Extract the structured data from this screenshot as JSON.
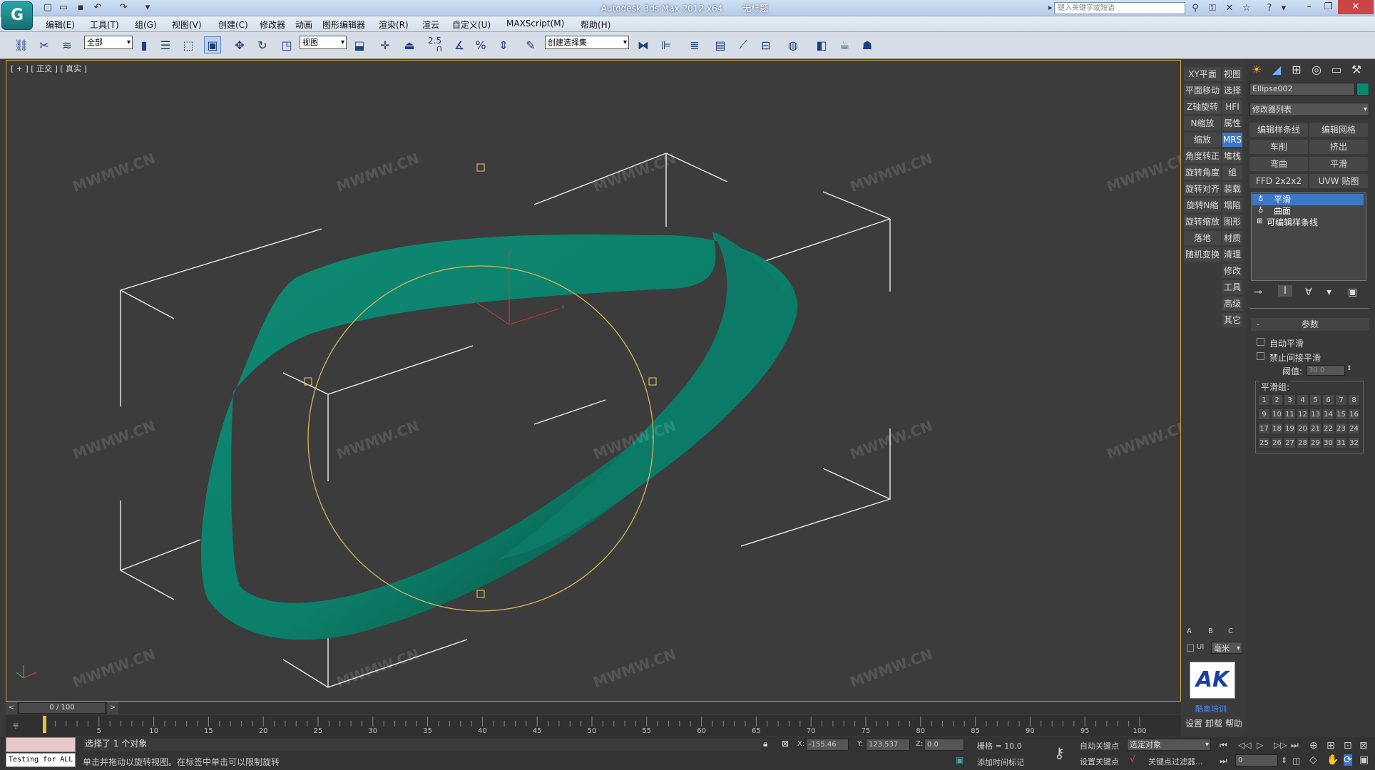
{
  "app": {
    "logo": "G",
    "title": "Autodesk 3ds Max  2012 x64",
    "doc": "无标题",
    "search_placeholder": "键入关键字或短语"
  },
  "quick_access": [
    "new-file-icon",
    "open-file-icon",
    "save-icon",
    "undo-icon",
    "redo-icon",
    "dropdown-icon"
  ],
  "menu": [
    "编辑(E)",
    "工具(T)",
    "组(G)",
    "视图(V)",
    "创建(C)",
    "修改器",
    "动画",
    "图形编辑器",
    "渲染(R)",
    "渲云",
    "自定义(U)",
    "MAXScript(M)",
    "帮助(H)"
  ],
  "toolbar": {
    "filter": "全部",
    "ref_coord": "视图",
    "named_sel": "创建选择集",
    "snap_label": "2.5"
  },
  "viewport": {
    "label": "[ + ] [ 正交 ] [ 真实 ]",
    "watermark": "MWMW.CN",
    "axis_z": "z",
    "axis_x": "x",
    "axis_y": "y",
    "colors": {
      "ribbon": "#0b8e78",
      "spline": "#d6b45a",
      "box": "#eeeeee"
    }
  },
  "command_col": {
    "left": [
      "XY平面",
      "平面移动",
      "Z轴旋转",
      "N缩放",
      "缩放",
      "角度转正",
      "旋转角度",
      "旋转对齐",
      "旋转N缩",
      "旋转缩放",
      "落地",
      "随机变换"
    ],
    "right": [
      "视图",
      "选择",
      "HFI",
      "属性",
      "MRS",
      "堆栈",
      "组",
      "装载",
      "塌陷",
      "图形",
      "材质",
      "清理",
      "修改",
      "工具",
      "高级",
      "其它"
    ],
    "abc": [
      "A",
      "B",
      "C"
    ],
    "unit_ui": "UI",
    "unit": "毫米",
    "brand": "AK",
    "brand_sub": "酷奥培训",
    "footer": [
      "设置",
      "卸载",
      "帮助"
    ]
  },
  "panel": {
    "object_name": "Ellipse002",
    "object_color": "#0a8a6c",
    "modifier_list": "修改器列表",
    "buttons": [
      "编辑样条线",
      "编辑网格",
      "车削",
      "挤出",
      "弯曲",
      "平滑",
      "FFD 2x2x2",
      "UVW 贴图"
    ],
    "stack": [
      "平滑",
      "曲面",
      "可编辑样条线"
    ],
    "rollout": "参数",
    "auto_smooth": "自动平滑",
    "prevent_indirect": "禁止间接平滑",
    "threshold_label": "阈值:",
    "threshold": "30.0",
    "smooth_groups_label": "平滑组:",
    "smooth_groups": [
      "1",
      "2",
      "3",
      "4",
      "5",
      "6",
      "7",
      "8",
      "9",
      "10",
      "11",
      "12",
      "13",
      "14",
      "15",
      "16",
      "17",
      "18",
      "19",
      "20",
      "21",
      "22",
      "23",
      "24",
      "25",
      "26",
      "27",
      "28",
      "29",
      "30",
      "31",
      "32"
    ]
  },
  "timeline": {
    "frame": "0 / 100",
    "ticks": [
      "5",
      "10",
      "15",
      "20",
      "25",
      "30",
      "35",
      "40",
      "45",
      "50",
      "55",
      "60",
      "65",
      "70",
      "75",
      "80",
      "85",
      "90",
      "95",
      "100"
    ]
  },
  "status": {
    "script_listener": "Testing for ALL",
    "selection": "选择了 1 个对象",
    "prompt": "单击并拖动以旋转视图。在标签中单击可以限制旋转",
    "x_label": "X:",
    "x": "-155.46",
    "y_label": "Y:",
    "y": "123.537",
    "z_label": "Z:",
    "z": "0.0",
    "grid": "栅格 = 10.0",
    "add_time_tag": "添加时间标记",
    "auto_key": "自动关键点",
    "set_key": "设置关键点",
    "key_mode": "选定对象",
    "key_filters": "关键点过滤器...",
    "frame_field": "0"
  }
}
